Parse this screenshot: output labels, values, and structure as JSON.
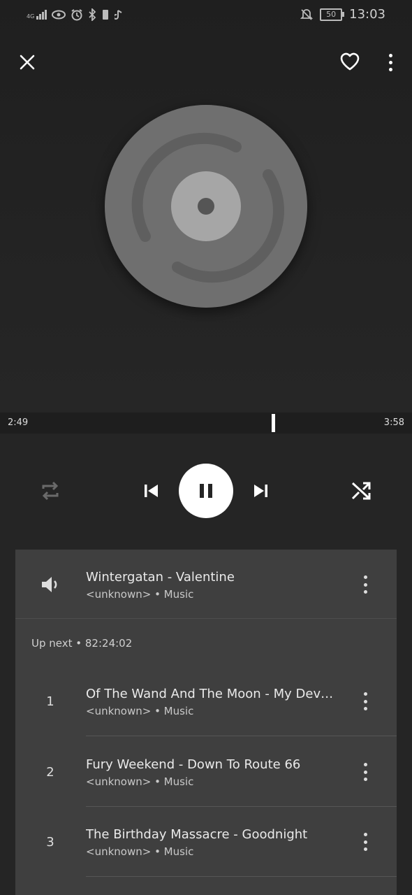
{
  "status_bar": {
    "network": "4G",
    "battery": "50",
    "time": "13:03"
  },
  "player": {
    "elapsed": "2:49",
    "duration": "3:58",
    "progress": 0.663
  },
  "now_playing": {
    "title": "Wintergatan - Valentine",
    "subtitle": "<unknown>  •  Music"
  },
  "queue": {
    "header": "Up next  •  82:24:02",
    "items": [
      {
        "num": "1",
        "title": "Of The Wand And The Moon - My Devot…",
        "subtitle": "<unknown>  •  Music"
      },
      {
        "num": "2",
        "title": "Fury Weekend - Down To Route 66",
        "subtitle": "<unknown>  •  Music"
      },
      {
        "num": "3",
        "title": "The Birthday Massacre - Goodnight",
        "subtitle": "<unknown>  •  Music"
      }
    ]
  },
  "icons": [
    "close-icon",
    "heart-icon",
    "more-vert-icon",
    "repeat-icon",
    "skip-previous-icon",
    "pause-icon",
    "skip-next-icon",
    "shuffle-icon",
    "volume-icon"
  ],
  "colors": {
    "accent": "#ffffff",
    "background": "#252525",
    "panel": "#3f3f3f"
  }
}
